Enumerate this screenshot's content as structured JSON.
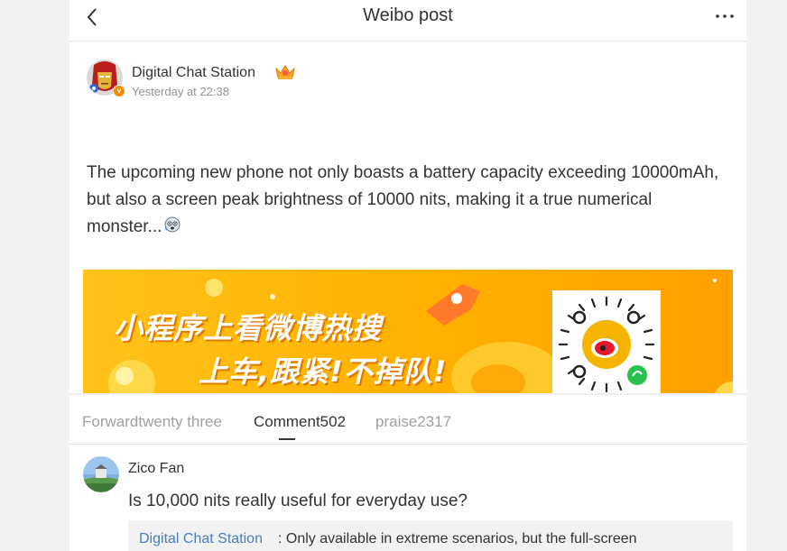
{
  "header": {
    "title": "Weibo post",
    "back_icon": "chevron-left-icon",
    "more_icon": "more-dots-icon"
  },
  "post": {
    "author_name": "Digital Chat Station",
    "time": "Yesterday at 22:38",
    "text": "The upcoming new phone not only boasts a battery capacity exceeding 10000mAh, but also a screen peak brightness of 10000 nits, making it a true numerical monster...",
    "verified_badge": "v",
    "banner": {
      "line1": "小程序上看微博热搜",
      "line2": "上车,跟紧!不掉队!"
    }
  },
  "tabs": [
    {
      "label": "Forwardtwenty three",
      "active": false
    },
    {
      "label": "Comment502",
      "active": true
    },
    {
      "label": "praise2317",
      "active": false
    }
  ],
  "comment": {
    "name": "Zico Fan",
    "text": "Is 10,000 nits really useful for everyday use?",
    "reply": {
      "author": "Digital Chat Station",
      "text": ": Only available in extreme scenarios, but the full-screen"
    }
  },
  "colors": {
    "accent_link": "#4a7dbf",
    "banner_orange": "#ffb000",
    "badge_orange": "#f78c00"
  }
}
